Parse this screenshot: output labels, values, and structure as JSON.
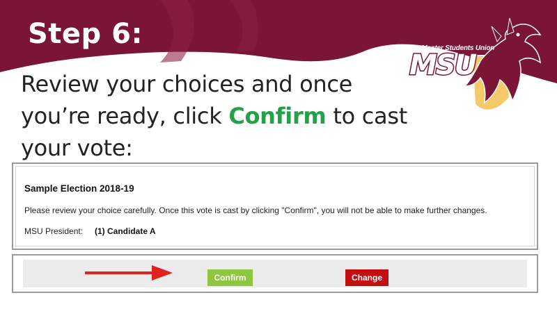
{
  "slide": {
    "step_heading": "Step 6:",
    "instruction_before": "Review your choices and once you’re ready, click ",
    "instruction_accent": "Confirm",
    "instruction_after": " to cast your vote:",
    "colors": {
      "banner": "#7a1535",
      "accent_green": "#23a148",
      "confirm_button": "#8dc63f",
      "change_button": "#c40f12",
      "arrow": "#e0241b"
    }
  },
  "logo": {
    "caption": "McMaster Students Union",
    "wordmark": "MSU",
    "icon": "hawk-mascot-icon"
  },
  "ballot_review": {
    "election_title": "Sample Election 2018-19",
    "message": "Please review your choice carefully. Once this vote is cast by clicking \"Confirm\", you will not be able to make further changes.",
    "position_label": "MSU President:",
    "choice": "(1) Candidate A"
  },
  "actions": {
    "confirm_label": "Confirm",
    "change_label": "Change",
    "pointer_icon": "arrow-right-icon"
  }
}
